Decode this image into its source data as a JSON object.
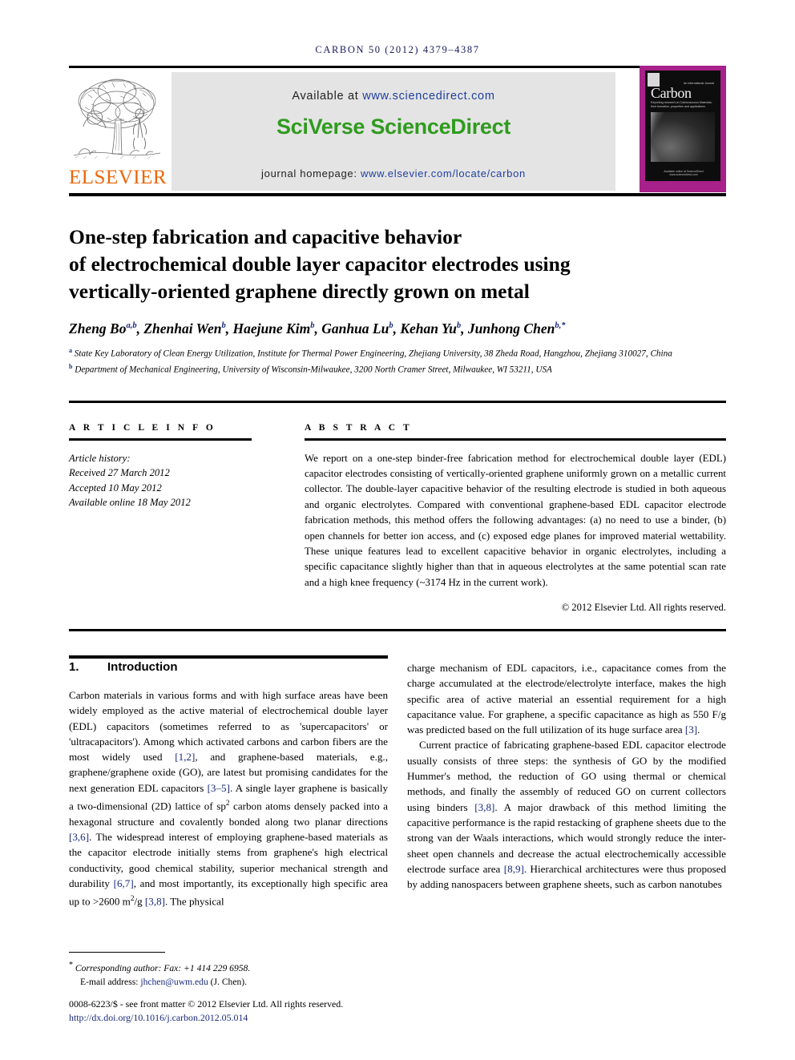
{
  "running_head": "CARBON 50 (2012) 4379–4387",
  "masthead": {
    "publisher_name": "ELSEVIER",
    "available_prefix": "Available at ",
    "available_url": "www.sciencedirect.com",
    "brand": "SciVerse ScienceDirect",
    "homepage_prefix": "journal homepage: ",
    "homepage_url": "www.elsevier.com/locate/carbon",
    "cover": {
      "title": "Carbon",
      "superline": "An International Journal",
      "subtitle": "Reporting research on Carbonaceous Materials; their formation, properties and applications",
      "footer": "Available online at ScienceDirect www.sciencedirect.com"
    }
  },
  "article": {
    "title": "One-step fabrication and capacitive behavior of electrochemical double layer capacitor electrodes using vertically-oriented graphene directly grown on metal",
    "title_lines": [
      "One-step fabrication and capacitive behavior",
      "of electrochemical double layer capacitor electrodes using",
      "vertically-oriented graphene directly grown on metal"
    ],
    "authors_line": "Zheng Bo a,b, Zhenhai Wen b, Haejune Kim b, Ganhua Lu b, Kehan Yu b, Junhong Chen b,*",
    "authors": [
      {
        "name": "Zheng Bo",
        "marks": "a,b"
      },
      {
        "name": "Zhenhai Wen",
        "marks": "b"
      },
      {
        "name": "Haejune Kim",
        "marks": "b"
      },
      {
        "name": "Ganhua Lu",
        "marks": "b"
      },
      {
        "name": "Kehan Yu",
        "marks": "b"
      },
      {
        "name": "Junhong Chen",
        "marks": "b,*"
      }
    ],
    "affiliations": [
      {
        "mark": "a",
        "text": "State Key Laboratory of Clean Energy Utilization, Institute for Thermal Power Engineering, Zhejiang University, 38 Zheda Road, Hangzhou, Zhejiang 310027, China"
      },
      {
        "mark": "b",
        "text": "Department of Mechanical Engineering, University of Wisconsin-Milwaukee, 3200 North Cramer Street, Milwaukee, WI 53211, USA"
      }
    ]
  },
  "article_info": {
    "heading": "A R T I C L E   I N F O",
    "history_label": "Article history:",
    "received": "Received 27 March 2012",
    "accepted": "Accepted 10 May 2012",
    "available_online": "Available online 18 May 2012"
  },
  "abstract": {
    "heading": "A B S T R A C T",
    "text": "We report on a one-step binder-free fabrication method for electrochemical double layer (EDL) capacitor electrodes consisting of vertically-oriented graphene uniformly grown on a metallic current collector. The double-layer capacitive behavior of the resulting electrode is studied in both aqueous and organic electrolytes. Compared with conventional graphene-based EDL capacitor electrode fabrication methods, this method offers the following advantages: (a) no need to use a binder, (b) open channels for better ion access, and (c) exposed edge planes for improved material wettability. These unique features lead to excellent capacitive behavior in organic electrolytes, including a specific capacitance slightly higher than that in aqueous electrolytes at the same potential scan rate and a high knee frequency (~3174 Hz in the current work).",
    "copyright": "© 2012 Elsevier Ltd. All rights reserved."
  },
  "section": {
    "number": "1.",
    "title": "Introduction"
  },
  "body": {
    "left_paragraph": "Carbon materials in various forms and with high surface areas have been widely employed as the active material of electrochemical double layer (EDL) capacitors (sometimes referred to as 'supercapacitors' or 'ultracapacitors'). Among which activated carbons and carbon fibers are the most widely used [1,2], and graphene-based materials, e.g., graphene/graphene oxide (GO), are latest but promising candidates for the next generation EDL capacitors [3–5]. A single layer graphene is basically a two-dimensional (2D) lattice of sp2 carbon atoms densely packed into a hexagonal structure and covalently bonded along two planar directions [3,6]. The widespread interest of employing graphene-based materials as the capacitor electrode initially stems from graphene's high electrical conductivity, good chemical stability, superior mechanical strength and durability [6,7], and most importantly, its exceptionally high specific area up to >2600 m2/g [3,8]. The physical",
    "right_paragraph_1": "charge mechanism of EDL capacitors, i.e., capacitance comes from the charge accumulated at the electrode/electrolyte interface, makes the high specific area of active material an essential requirement for a high capacitance value. For graphene, a specific capacitance as high as 550 F/g was predicted based on the full utilization of its huge surface area [3].",
    "right_paragraph_2": "Current practice of fabricating graphene-based EDL capacitor electrode usually consists of three steps: the synthesis of GO by the modified Hummer's method, the reduction of GO using thermal or chemical methods, and finally the assembly of reduced GO on current collectors using binders [3,8]. A major drawback of this method limiting the capacitive performance is the rapid restacking of graphene sheets due to the strong van der Waals interactions, which would strongly reduce the inter-sheet open channels and decrease the actual electrochemically accessible electrode surface area [8,9]. Hierarchical architectures were thus proposed by adding nanospacers between graphene sheets, such as carbon nanotubes"
  },
  "footer": {
    "corresponding": "Corresponding author: Fax: +1 414 229 6958.",
    "email_label": "E-mail address: ",
    "email": "jhchen@uwm.edu",
    "email_suffix": " (J. Chen).",
    "issn": "0008-6223/$ - see front matter © 2012 Elsevier Ltd. All rights reserved.",
    "doi": "http://dx.doi.org/10.1016/j.carbon.2012.05.014"
  },
  "colors": {
    "elsevier_orange": "#eb6608",
    "sciencedirect_green": "#2f9b1e",
    "link_blue": "#1a2a7a",
    "cover_magenta": "#a8208a"
  }
}
